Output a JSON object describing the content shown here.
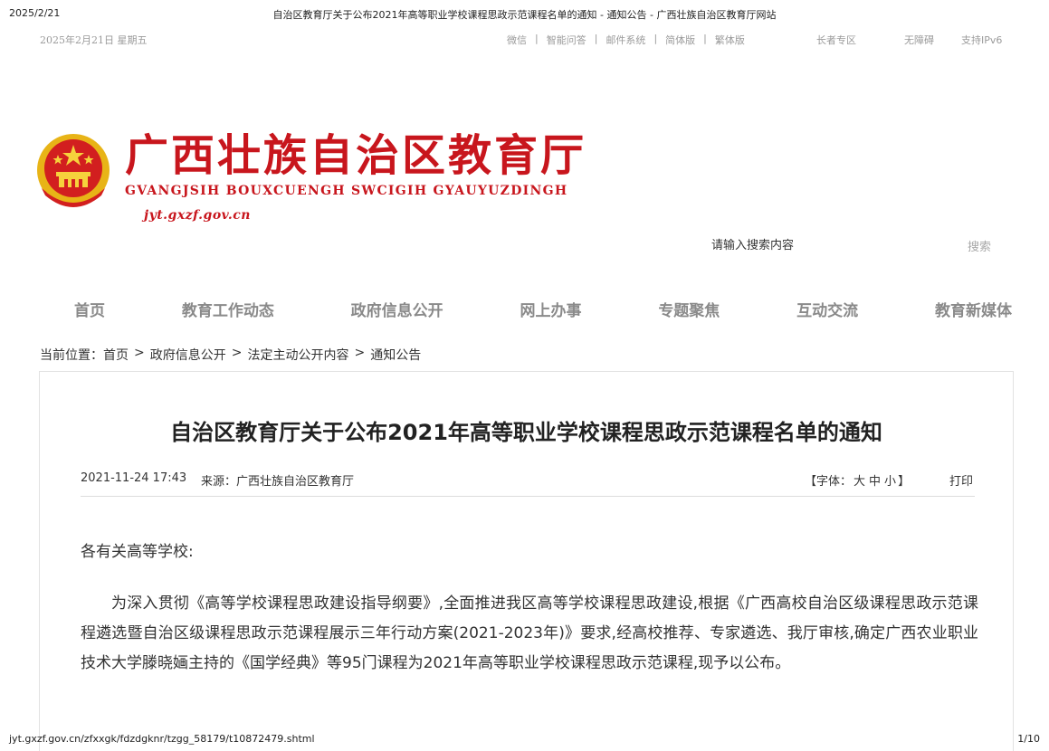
{
  "print_header": {
    "date": "2025/2/21",
    "title": "自治区教育厅关于公布2021年高等职业学校课程思政示范课程名单的通知 - 通知公告 - 广西壮族自治区教育厅网站"
  },
  "topbar": {
    "today": "2025年2月21日  星期五",
    "links": [
      "微信",
      "智能问答",
      "邮件系统",
      "简体版",
      "繁体版"
    ],
    "elder": "长者专区",
    "accessibility": "无障碍",
    "ipv6": "支持IPv6"
  },
  "site": {
    "name_cn": "广西壮族自治区教育厅",
    "name_za": "GVANGJSIH BOUXCUENGH SWCIGIH GYAUYUZDINGH",
    "domain": "jyt.gxzf.gov.cn"
  },
  "search": {
    "placeholder": "请输入搜索内容",
    "button": "搜索"
  },
  "nav": [
    "首页",
    "教育工作动态",
    "政府信息公开",
    "网上办事",
    "专题聚焦",
    "互动交流",
    "教育新媒体"
  ],
  "breadcrumb": {
    "label": "当前位置：",
    "items": [
      "首页",
      "政府信息公开",
      "法定主动公开内容",
      "通知公告"
    ],
    "separator": ">"
  },
  "article": {
    "title": "自治区教育厅关于公布2021年高等职业学校课程思政示范课程名单的通知",
    "datetime": "2021-11-24 17:43",
    "source": "来源：广西壮族自治区教育厅",
    "font_label": "【字体：",
    "font_large": "大",
    "font_medium": "中",
    "font_small": "小",
    "font_close": "】",
    "print": "打印",
    "salutation": "各有关高等学校:",
    "paragraph": "为深入贯彻《高等学校课程思政建设指导纲要》,全面推进我区高等学校课程思政建设,根据《广西高校自治区级课程思政示范课程遴选暨自治区级课程思政示范课程展示三年行动方案(2021-2023年)》要求,经高校推荐、专家遴选、我厅审核,确定广西农业职业技术大学滕晓婳主持的《国学经典》等95门课程为2021年高等职业学校课程思政示范课程,现予以公布。"
  },
  "print_footer": {
    "url": "jyt.gxzf.gov.cn/zfxxgk/fdzdgknr/tzgg_58179/t10872479.shtml",
    "page": "1/10"
  },
  "colors": {
    "brand_red": "#c8161d",
    "emblem_gold": "#e8b417",
    "nav_gray": "#8a8a8a"
  }
}
